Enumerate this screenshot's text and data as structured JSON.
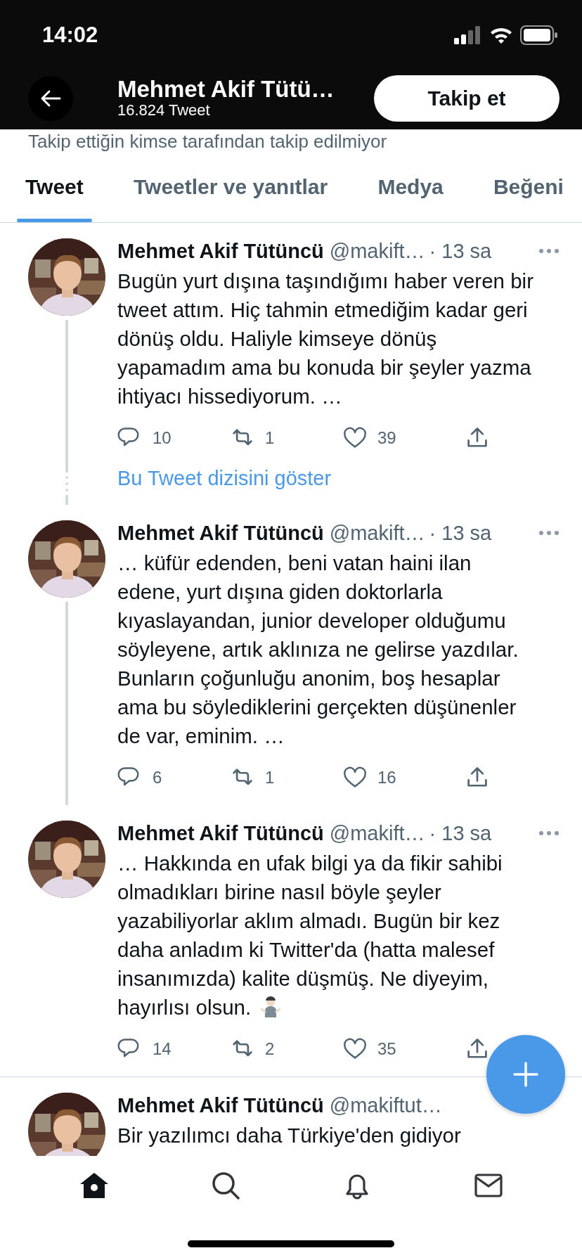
{
  "status_bar": {
    "time": "14:02"
  },
  "header": {
    "name": "Mehmet Akif Tütü…",
    "count": "16.824 Tweet",
    "follow_button": "Takip et"
  },
  "follow_note": "Takip ettiğin kimse tarafından takip edilmiyor",
  "tabs": [
    {
      "label": "Tweet",
      "selected": true
    },
    {
      "label": "Tweetler ve yanıtlar",
      "selected": false
    },
    {
      "label": "Medya",
      "selected": false
    },
    {
      "label": "Beğeni",
      "selected": false
    }
  ],
  "tweets": [
    {
      "name": "Mehmet Akif Tütüncü",
      "handle": "@makift…",
      "time": "· 13 sa",
      "text": "Bugün yurt dışına taşındığımı haber veren bir tweet attım. Hiç tahmin etmediğim kadar geri dönüş oldu. Haliyle kimseye dönüş yapamadım ama bu konuda bir şeyler yazma ihtiyacı hissediyorum. …",
      "replies": "10",
      "retweets": "1",
      "likes": "39",
      "thread_below": true,
      "show_thread": "Bu Tweet dizisini göster"
    },
    {
      "name": "Mehmet Akif Tütüncü",
      "handle": "@makift…",
      "time": "· 13 sa",
      "text": "… küfür edenden, beni vatan haini ilan edene, yurt dışına giden doktorlarla kıyaslayandan, junior developer olduğumu söyleyene, artık aklınıza ne gelirse yazdılar. Bunların çoğunluğu anonim, boş hesaplar ama bu söylediklerini gerçekten düşünenler de var, eminim. …",
      "replies": "6",
      "retweets": "1",
      "likes": "16",
      "thread_below": true
    },
    {
      "name": "Mehmet Akif Tütüncü",
      "handle": "@makift…",
      "time": "· 13 sa",
      "text": "… Hakkında en ufak bilgi ya da fikir sahibi olmadıkları birine nasıl böyle şeyler yazabiliyorlar aklım almadı. Bugün bir kez daha anladım ki Twitter'da (hatta malesef insanımızda) kalite düşmüş. Ne diyeyim, hayırlısı olsun.",
      "emoji": {
        "kind": "shrug"
      },
      "replies": "14",
      "retweets": "2",
      "likes": "35",
      "thread_below": false
    },
    {
      "name": "Mehmet Akif Tütüncü",
      "handle": "@makiftut…",
      "text": "Bir yazılımcı daha Türkiye'den gidiyor",
      "thread_below": false
    }
  ],
  "bottom_nav": [
    {
      "kind": "home",
      "selected": true
    },
    {
      "kind": "search",
      "selected": false
    },
    {
      "kind": "notifications",
      "selected": false
    },
    {
      "kind": "messages",
      "selected": false
    }
  ]
}
